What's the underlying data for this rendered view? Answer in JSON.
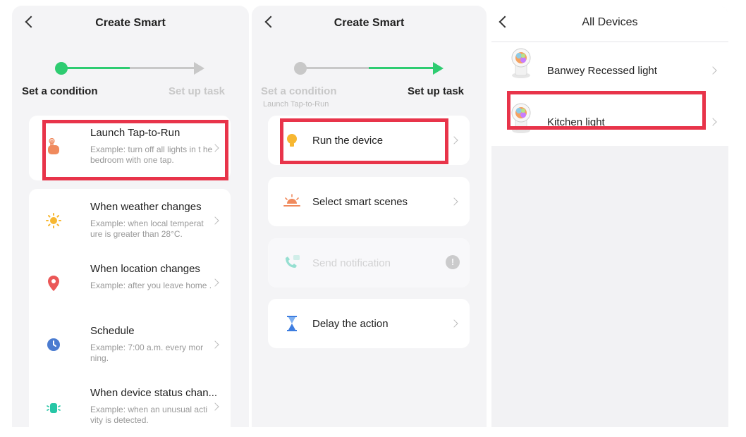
{
  "panel1": {
    "title": "Create Smart",
    "step1_label": "Set a condition",
    "step2_label": "Set up task",
    "items": [
      {
        "title": "Launch Tap-to-Run",
        "desc": "Example: turn off all lights in t he bedroom with one tap.",
        "icon": "hand-tap-icon"
      },
      {
        "title": "When weather changes",
        "desc": "Example: when local temperat ure is greater than 28°C.",
        "icon": "sun-icon"
      },
      {
        "title": "When location changes",
        "desc": "Example: after you leave home .",
        "icon": "location-pin-icon"
      },
      {
        "title": "Schedule",
        "desc": "Example: 7:00 a.m. every mor ning.",
        "icon": "clock-icon"
      },
      {
        "title": "When device status chan...",
        "desc": "Example: when an unusual acti vity is detected.",
        "icon": "device-status-icon"
      }
    ]
  },
  "panel2": {
    "title": "Create Smart",
    "step1_label": "Set a condition",
    "step1_sub": "Launch Tap-to-Run",
    "step2_label": "Set up task",
    "items": [
      {
        "title": "Run the device",
        "icon": "bulb-icon"
      },
      {
        "title": "Select smart scenes",
        "icon": "sunrise-icon"
      },
      {
        "title": "Send notification",
        "icon": "notification-icon",
        "disabled": true
      },
      {
        "title": "Delay the action",
        "icon": "hourglass-icon"
      }
    ]
  },
  "panel3": {
    "title": "All Devices",
    "devices": [
      {
        "name": "Banwey Recessed light",
        "icon": "light-bulb-device-icon"
      },
      {
        "name": "Kitchen light",
        "icon": "light-bulb-device-icon"
      }
    ]
  },
  "colors": {
    "accent_green": "#2ecc71",
    "highlight_red": "#e8344a",
    "inactive_gray": "#c8c8c8"
  }
}
